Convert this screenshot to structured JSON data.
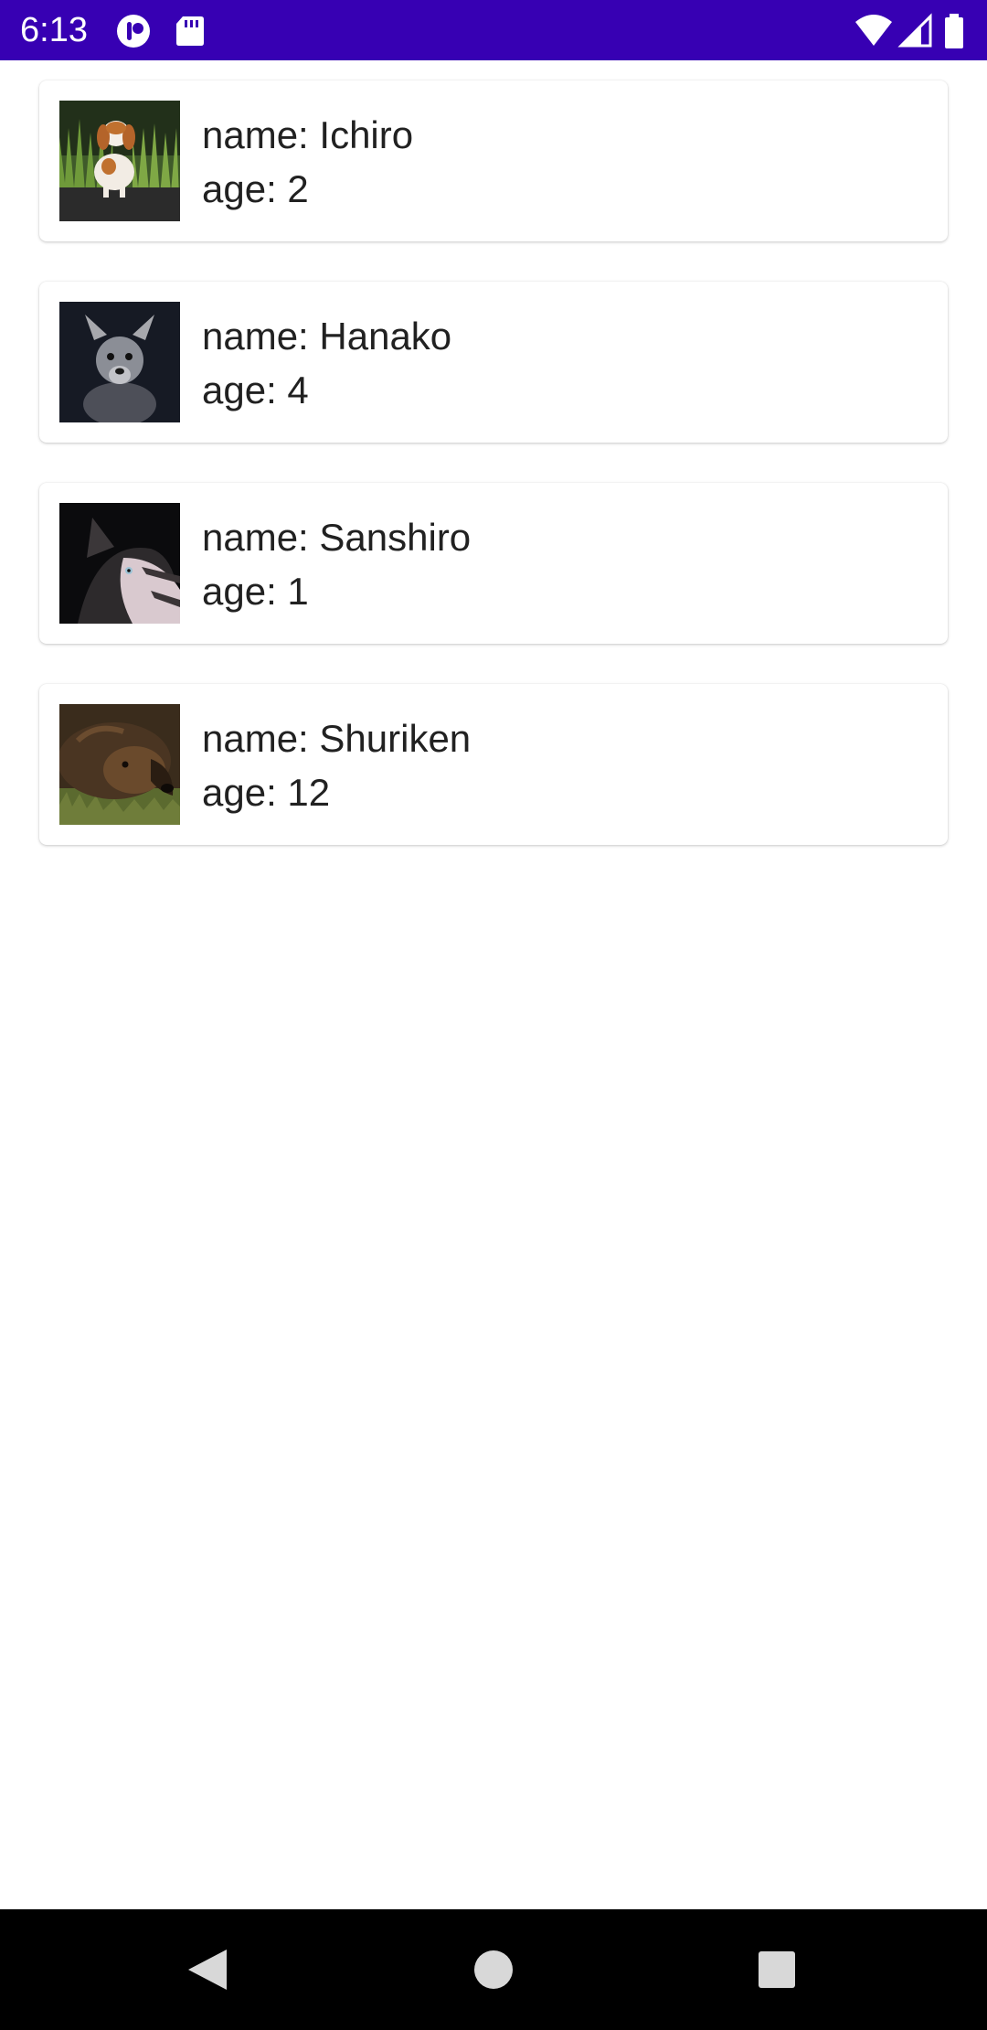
{
  "status_bar": {
    "time": "6:13",
    "background_color": "#3700b3",
    "left_icons": [
      "notification-app-icon",
      "sd-card-icon"
    ],
    "right_icons": [
      "wifi-icon",
      "cell-signal-icon",
      "battery-icon"
    ]
  },
  "pets": [
    {
      "name_text": "name: Ichiro",
      "age_text": "age: 2",
      "photo": "cavalier-spaniel-photo"
    },
    {
      "name_text": "name: Hanako",
      "age_text": "age: 4",
      "photo": "small-terrier-photo"
    },
    {
      "name_text": "name: Sanshiro",
      "age_text": "age: 1",
      "photo": "husky-photo"
    },
    {
      "name_text": "name: Shuriken",
      "age_text": "age: 12",
      "photo": "shepherd-dog-photo"
    }
  ],
  "nav_bar": {
    "buttons": [
      "back-icon",
      "home-icon",
      "recents-icon"
    ]
  }
}
